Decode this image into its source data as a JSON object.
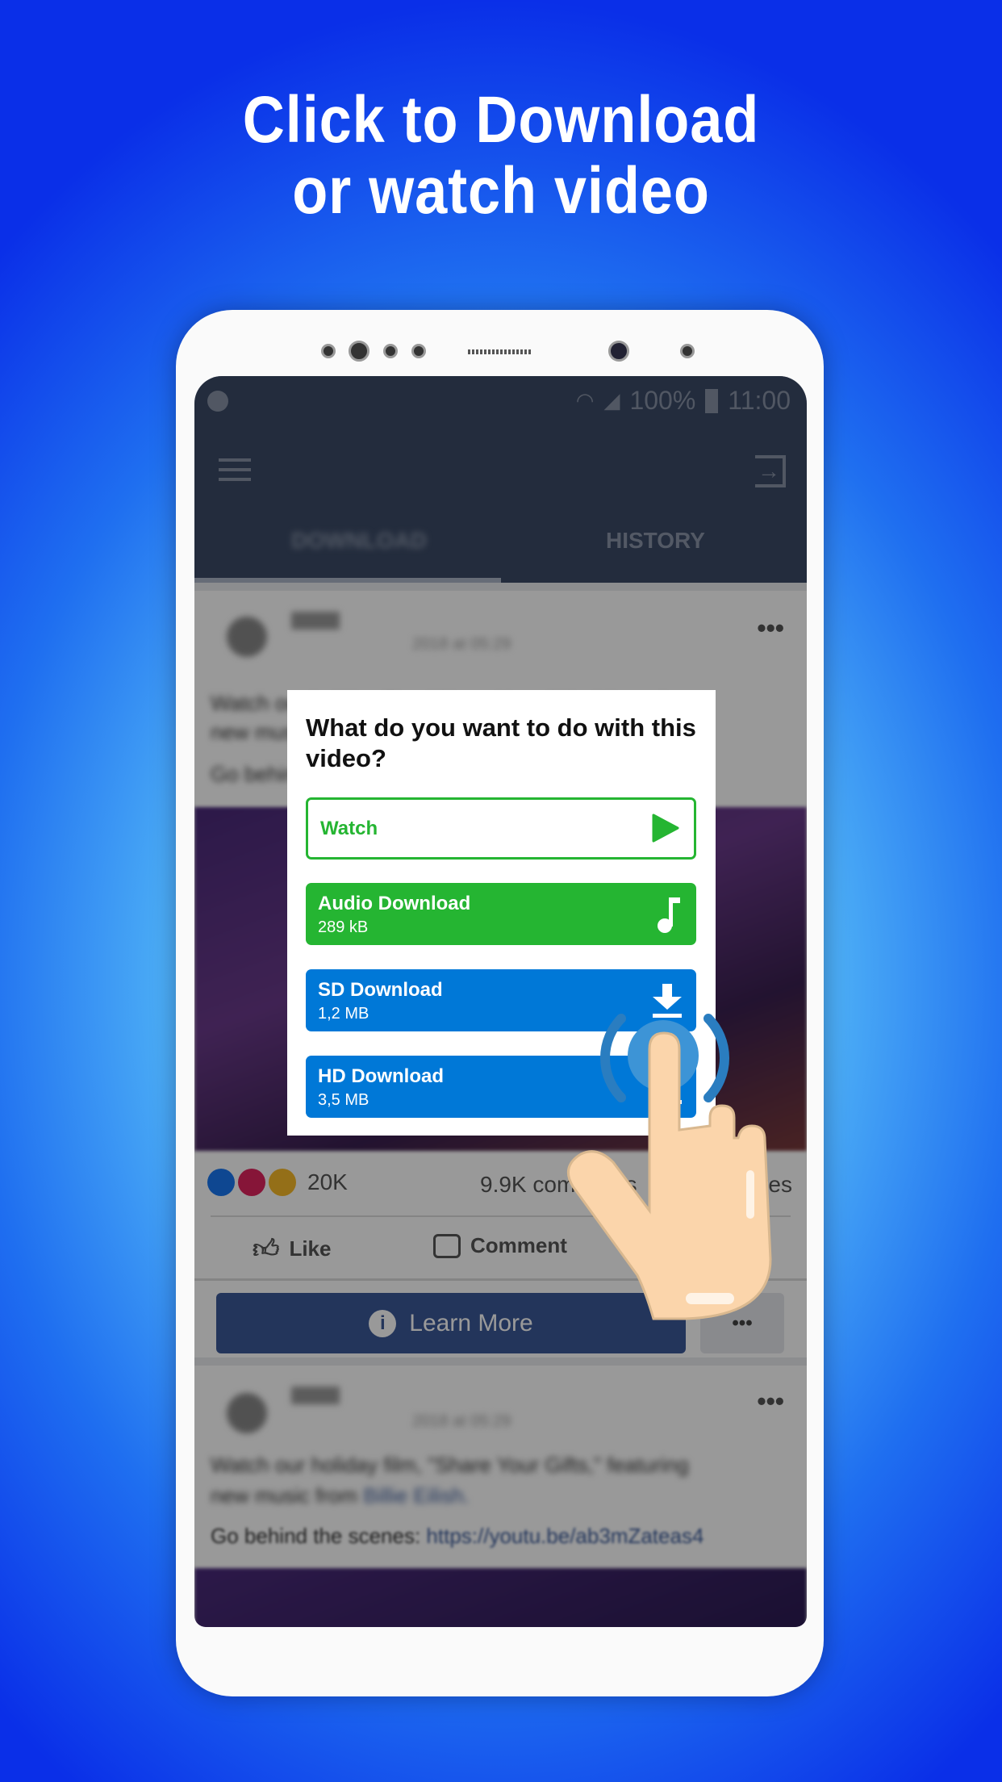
{
  "headline": {
    "line1": "Click to Download",
    "line2": "or watch video"
  },
  "status_bar": {
    "battery": "100%",
    "time": "11:00"
  },
  "app_bar": {
    "tabs": [
      {
        "label": "DOWNLOAD"
      },
      {
        "label": "HISTORY"
      }
    ]
  },
  "post1": {
    "date": "2018 at 05:29",
    "text1": "Watch our holiday film, \"Share Your Gifts,\" featuring",
    "text2": "new music from Billie Eilish.",
    "text3": "Go behind the scenes: https://youtu.be/ab3mZateas4",
    "reactions": "20K",
    "comments": "9.9K comments",
    "shares": "shares",
    "like": "Like",
    "comment": "Comment",
    "learn_more": "Learn More"
  },
  "post2": {
    "date": "2018 at 05:29",
    "text1": "Watch our holiday film, \"Share Your Gifts,\" featuring",
    "text2": "new music from ",
    "link1": "Billie Eilish.",
    "text3": "Go behind the scenes: ",
    "link3": "https://youtu.be/ab3mZateas4"
  },
  "dialog": {
    "title": "What do you want to do with this video?",
    "options": [
      {
        "label": "Watch",
        "icon": "play-icon"
      },
      {
        "label": "Audio Download",
        "size": "289 kB",
        "icon": "music-note-icon"
      },
      {
        "label": "SD Download",
        "size": "1,2 MB",
        "icon": "download-icon"
      },
      {
        "label": "HD Download",
        "size": "3,5 MB",
        "icon": "download-icon"
      }
    ]
  },
  "colors": {
    "green": "#25b532",
    "blue": "#0078d7",
    "appbar": "#3b4a66",
    "fb_blue": "#3b5998"
  }
}
